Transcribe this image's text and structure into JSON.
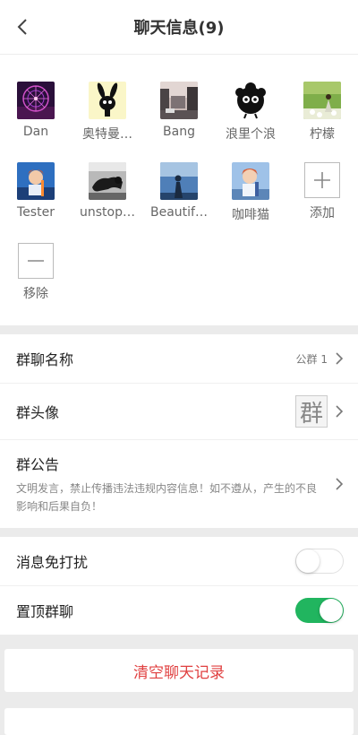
{
  "header": {
    "title": "聊天信息(9)"
  },
  "members": [
    {
      "name": "Dan",
      "icon": "ferris-wheel-avatar"
    },
    {
      "name": "奥特曼…",
      "icon": "bunny-creature-avatar"
    },
    {
      "name": "Bang",
      "icon": "city-street-avatar"
    },
    {
      "name": "浪里个浪",
      "icon": "soot-sprite-avatar"
    },
    {
      "name": "柠檬",
      "icon": "girl-in-field-avatar"
    },
    {
      "name": "Tester",
      "icon": "anime-boy-blue-avatar"
    },
    {
      "name": "unstop…",
      "icon": "black-panther-avatar"
    },
    {
      "name": "Beautif…",
      "icon": "woman-silhouette-avatar"
    },
    {
      "name": "咖啡猫",
      "icon": "anime-boy-sky-avatar"
    }
  ],
  "actions": {
    "add_label": "添加",
    "remove_label": "移除"
  },
  "info": {
    "group_name_label": "群聊名称",
    "group_name_value": "公群 1",
    "group_avatar_label": "群头像",
    "group_avatar_char": "群",
    "notice_label": "群公告",
    "notice_text": "文明发言，禁止传播违法违规内容信息！如不遵从，产生的不良影响和后果自负！"
  },
  "settings": {
    "mute_label": "消息免打扰",
    "mute_enabled": false,
    "pin_label": "置顶群聊",
    "pin_enabled": true
  },
  "clear_history_label": "清空聊天记录",
  "colors": {
    "accent_green": "#21b55f",
    "danger_red": "#e04040"
  }
}
